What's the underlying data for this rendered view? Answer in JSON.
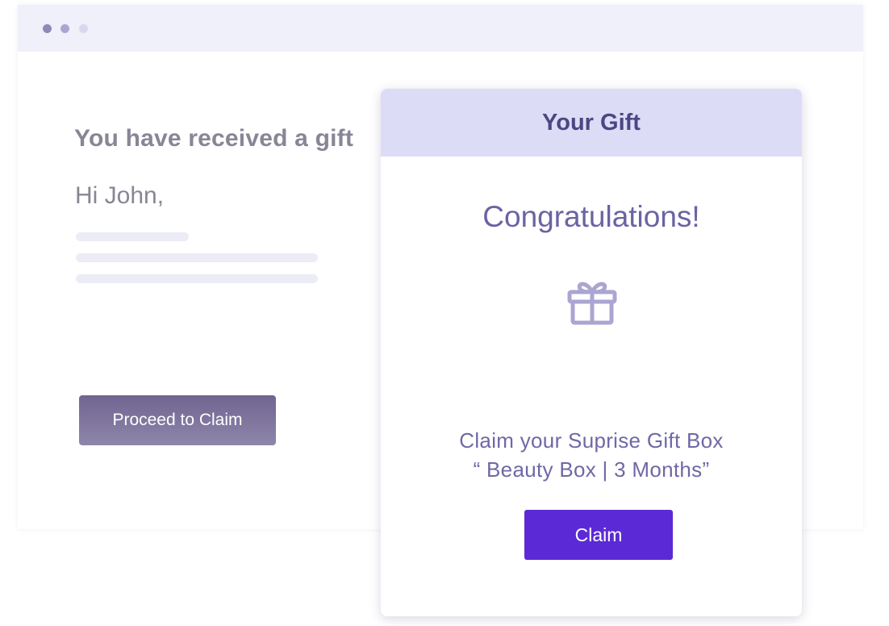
{
  "window": {
    "title_dots": [
      "dot",
      "dot",
      "dot"
    ]
  },
  "email": {
    "heading": "You have received a gift",
    "greeting": "Hi John,",
    "proceed_label": "Proceed to Claim"
  },
  "gift_card": {
    "header_title": "Your Gift",
    "congrats": "Congratulations!",
    "icon": "gift-icon",
    "claim_line1": "Claim your Suprise Gift Box",
    "claim_line2": "“ Beauty Box | 3 Months”",
    "claim_label": "Claim"
  },
  "colors": {
    "accent": "#5b2ad6",
    "header_bg": "#dcdcf6",
    "text_muted": "#898596",
    "text_purple": "#6a63a3"
  }
}
